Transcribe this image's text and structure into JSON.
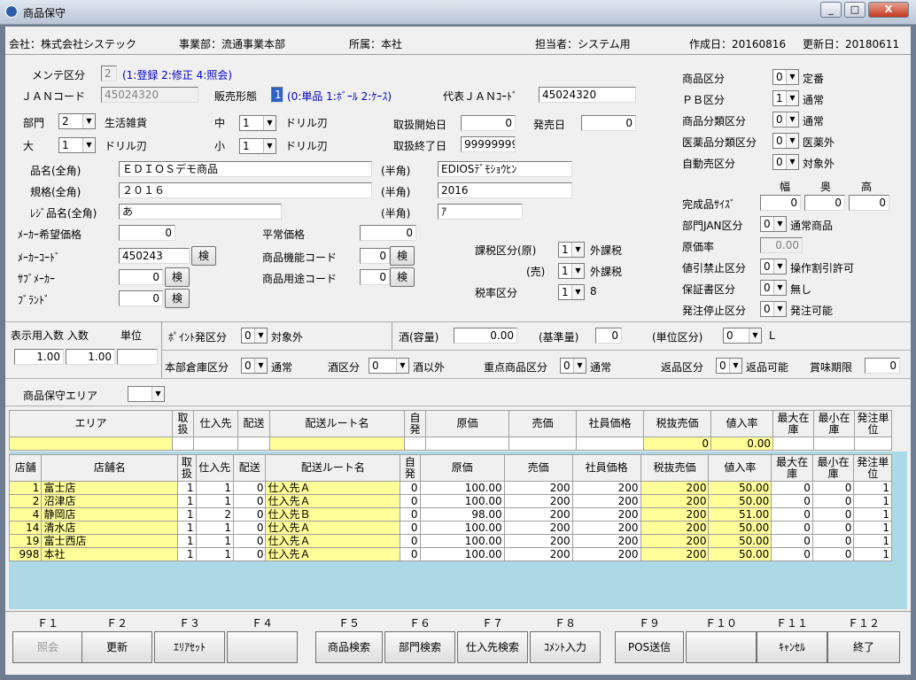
{
  "window": {
    "title": "商品保守",
    "min": "_",
    "max": "□",
    "close": "X"
  },
  "header": {
    "company": "会社：株式会社システック",
    "division": "事業部：流通事業本部",
    "affiliation": "所属：本社",
    "person": "担当者：システム用",
    "created": "作成日：20160816",
    "updated": "更新日：20180611"
  },
  "form": {
    "mode_label": "メンテ区分",
    "mode_value": "2",
    "mode_hint": "(1:登録 2:修正 4:照会)",
    "jan_label": "ＪＡＮコード",
    "jan_value": "45024320",
    "sales_form_label": "販売形態",
    "sales_form_value": "1",
    "sales_form_hint": "(0:単品 1:ﾎﾞｰﾙ 2:ｹｰｽ)",
    "rep_jan_label": "代表ＪＡＮｺｰﾄﾞ",
    "rep_jan_value": "45024320",
    "dept_label": "部門",
    "dept_value": "2",
    "dept_name": "生活雑貨",
    "mid_label": "中",
    "mid_value": "1",
    "mid_name": "ドリル刃",
    "large_label": "大",
    "large_value": "1",
    "large_name": "ドリル刃",
    "small_label": "小",
    "small_value": "1",
    "small_name": "ドリル刃",
    "start_label": "取扱開始日",
    "start_value": "0",
    "release_label": "発売日",
    "release_value": "0",
    "end_label": "取扱終了日",
    "end_value": "99999999",
    "name_label": "品名(全角)",
    "name_value": "ＥＤＩＯＳデモ商品",
    "half_label": "(半角)",
    "name_half": "EDIOSﾃﾞﾓｼｮｳﾋﾝ",
    "spec_label": "規格(全角)",
    "spec_value": "２０１６",
    "spec_half": "2016",
    "reg_label": "ﾚｼﾞ品名(全角)",
    "reg_value": "あ",
    "reg_half": "ｱ",
    "maker_price_label": "ﾒｰｶｰ希望価格",
    "maker_price_value": "0",
    "normal_price_label": "平常価格",
    "normal_price_value": "0",
    "maker_code_label": "ﾒｰｶｰｺｰﾄﾞ",
    "maker_code_value": "450243",
    "sub_maker_label": "ｻﾌﾞﾒｰｶｰ",
    "sub_maker_value": "0",
    "brand_label": "ﾌﾞﾗﾝﾄﾞ",
    "brand_value": "0",
    "func_code_label": "商品機能コード",
    "func_code_value": "0",
    "use_code_label": "商品用途コード",
    "use_code_value": "0",
    "search": "検",
    "tax_orig_label": "課税区分(原)",
    "tax_orig_value": "1",
    "tax_orig_name": "外課税",
    "tax_sale_label": "(売)",
    "tax_sale_value": "1",
    "tax_sale_name": "外課税",
    "tax_rate_label": "税率区分",
    "tax_rate_value": "1",
    "tax_rate_name": "8"
  },
  "right": {
    "item_kbn_label": "商品区分",
    "item_kbn_value": "0",
    "item_kbn_name": "定番",
    "pb_label": "ＰＢ区分",
    "pb_value": "1",
    "pb_name": "通常",
    "cls_label": "商品分類区分",
    "cls_value": "0",
    "cls_name": "通常",
    "med_label": "医薬品分類区分",
    "med_value": "0",
    "med_name": "医薬外",
    "auto_label": "自動売区分",
    "auto_value": "0",
    "auto_name": "対象外",
    "w_label": "幅",
    "d_label": "奥",
    "h_label": "高",
    "size_label": "完成品ｻｲｽﾞ",
    "w_value": "0",
    "d_value": "0",
    "h_value": "0",
    "deptjan_label": "部門JAN区分",
    "deptjan_value": "0",
    "deptjan_name": "通常商品",
    "cost_rate_label": "原価率",
    "cost_rate_value": "0.00",
    "discount_label": "値引禁止区分",
    "discount_value": "0",
    "discount_name": "操作割引許可",
    "warranty_label": "保証書区分",
    "warranty_value": "0",
    "warranty_name": "無し",
    "stop_label": "発注停止区分",
    "stop_value": "0",
    "stop_name": "発注可能"
  },
  "mid": {
    "disp_label": "表示用入数 入数",
    "unit_label": "単位",
    "disp_value": "1.00",
    "qty_value": "1.00",
    "unit_value": "",
    "point_label": "ﾎﾟｲﾝﾄ発区分",
    "point_value": "0",
    "point_name": "対象外",
    "sake_label": "酒(容量)",
    "sake_value": "0.00",
    "base_label": "(基準量)",
    "base_value": "0",
    "unitkbn_label": "(単位区分)",
    "unitkbn_value": "0",
    "unitkbn_name": "L",
    "hq_label": "本部倉庫区分",
    "hq_value": "0",
    "hq_name": "通常",
    "liquor_label": "酒区分",
    "liquor_value": "0",
    "liquor_name": "酒以外",
    "priority_label": "重点商品区分",
    "priority_value": "0",
    "priority_name": "通常",
    "return_label": "返品区分",
    "return_value": "0",
    "return_name": "返品可能",
    "expiry_label": "賞味期限",
    "expiry_value": "0",
    "area_label": "商品保守エリア",
    "area_value": ""
  },
  "grid1": {
    "headers": [
      "エリア",
      "取\n扱",
      "仕入先",
      "配送",
      "配送ルート名",
      "自\n発",
      "原価",
      "売価",
      "社員価格",
      "税抜売価",
      "値入率",
      "最大在\n庫",
      "最小在\n庫",
      "発注単\n位"
    ],
    "row": [
      "",
      "",
      "",
      "",
      "",
      "",
      "",
      "",
      "",
      "0",
      "0.00",
      "",
      "",
      ""
    ]
  },
  "grid2": {
    "headers": [
      "店舗",
      "店舗名",
      "取\n扱",
      "仕入先",
      "配送",
      "配送ルート名",
      "自\n発",
      "原価",
      "売価",
      "社員価格",
      "税抜売価",
      "値入率",
      "最大在\n庫",
      "最小在\n庫",
      "発注単\n位"
    ],
    "rows": [
      [
        "1",
        "富士店",
        "1",
        "1",
        "0",
        "仕入先Ａ",
        "0",
        "100.00",
        "200",
        "200",
        "200",
        "50.00",
        "0",
        "0",
        "1"
      ],
      [
        "2",
        "沼津店",
        "1",
        "1",
        "0",
        "仕入先Ａ",
        "0",
        "100.00",
        "200",
        "200",
        "200",
        "50.00",
        "0",
        "0",
        "1"
      ],
      [
        "4",
        "静岡店",
        "1",
        "2",
        "0",
        "仕入先Ｂ",
        "0",
        "98.00",
        "200",
        "200",
        "200",
        "51.00",
        "0",
        "0",
        "1"
      ],
      [
        "14",
        "清水店",
        "1",
        "1",
        "0",
        "仕入先Ａ",
        "0",
        "100.00",
        "200",
        "200",
        "200",
        "50.00",
        "0",
        "0",
        "1"
      ],
      [
        "19",
        "富士西店",
        "1",
        "1",
        "0",
        "仕入先Ａ",
        "0",
        "100.00",
        "200",
        "200",
        "200",
        "50.00",
        "0",
        "0",
        "1"
      ],
      [
        "998",
        "本社",
        "1",
        "1",
        "0",
        "仕入先Ａ",
        "0",
        "100.00",
        "200",
        "200",
        "200",
        "50.00",
        "0",
        "0",
        "1"
      ]
    ]
  },
  "fkeys": [
    {
      "key": "Ｆ１",
      "label": "照会",
      "enabled": false
    },
    {
      "key": "Ｆ２",
      "label": "更新",
      "enabled": true
    },
    {
      "key": "Ｆ３",
      "label": "ｴﾘｱｾｯﾄ",
      "enabled": true
    },
    {
      "key": "Ｆ４",
      "label": "",
      "enabled": true
    },
    {
      "key": "Ｆ５",
      "label": "商品検索",
      "enabled": true
    },
    {
      "key": "Ｆ６",
      "label": "部門検索",
      "enabled": true
    },
    {
      "key": "Ｆ７",
      "label": "仕入先検索",
      "enabled": true
    },
    {
      "key": "Ｆ８",
      "label": "ｺﾒﾝﾄ入力",
      "enabled": true
    },
    {
      "key": "Ｆ９",
      "label": "POS送信",
      "enabled": true
    },
    {
      "key": "Ｆ１０",
      "label": "",
      "enabled": true
    },
    {
      "key": "Ｆ１１",
      "label": "ｷｬﾝｾﾙ",
      "enabled": true
    },
    {
      "key": "Ｆ１２",
      "label": "終了",
      "enabled": true
    }
  ],
  "colors": {
    "highlight": "#ffff99",
    "grid_bg": "#add8e6",
    "hint": "#0000d0"
  }
}
